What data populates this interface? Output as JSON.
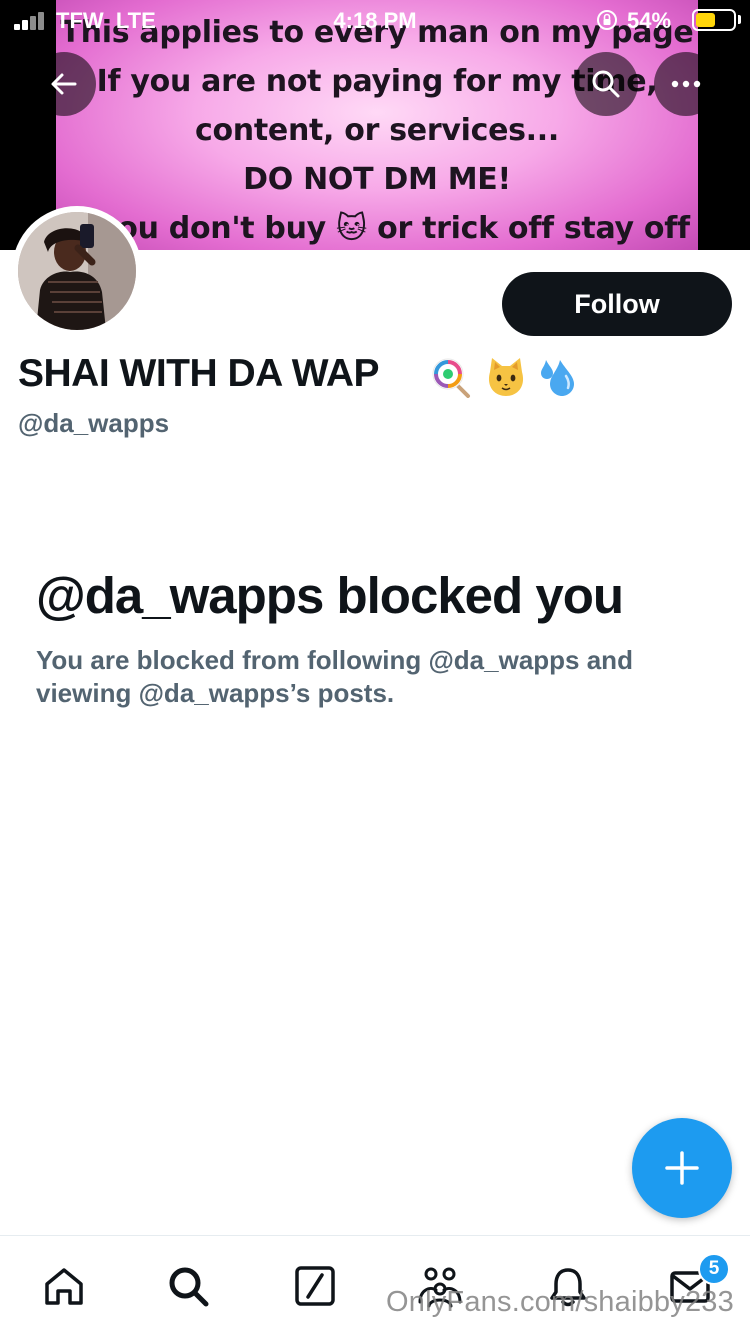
{
  "status_bar": {
    "carrier": "TFW  LTE",
    "time": "4:18 PM",
    "battery_percent": "54%",
    "battery_level": 0.54,
    "battery_color": "#ffd60a"
  },
  "banner": {
    "lines": [
      "This applies to every man on my page",
      "If you are not paying for my time,",
      "content, or services...",
      "DO NOT DM ME!",
      "If you don't buy 🐱 or trick off stay off"
    ],
    "gradient_colors": [
      "#ffd9f6",
      "#e36cd0"
    ]
  },
  "nav": {
    "back_icon": "arrow-left-icon",
    "search_icon": "search-icon",
    "more_icon": "more-horizontal-icon"
  },
  "profile": {
    "follow_label": "Follow",
    "display_name": "SHAI WITH DA WAP",
    "display_name_emojis": [
      "lollipop",
      "cat-face",
      "sweat-droplets"
    ],
    "handle": "@da_wapps"
  },
  "blocked": {
    "title": "@da_wapps blocked you",
    "message": "You are blocked from following @da_wapps and viewing @da_wapps’s posts."
  },
  "fab": {
    "icon": "plus-icon",
    "color": "#1d9bf0"
  },
  "tab_bar": {
    "tabs": [
      {
        "name": "home",
        "icon": "home-icon"
      },
      {
        "name": "search",
        "icon": "search-icon"
      },
      {
        "name": "grok",
        "icon": "slash-square-icon"
      },
      {
        "name": "communities",
        "icon": "people-icon"
      },
      {
        "name": "notifications",
        "icon": "bell-icon"
      },
      {
        "name": "messages",
        "icon": "mail-icon"
      }
    ],
    "messages_badge": "5"
  },
  "watermark": "OnlyFans.com/shaibby233",
  "colors": {
    "text_primary": "#0f1419",
    "text_secondary": "#536471",
    "accent": "#1d9bf0"
  }
}
